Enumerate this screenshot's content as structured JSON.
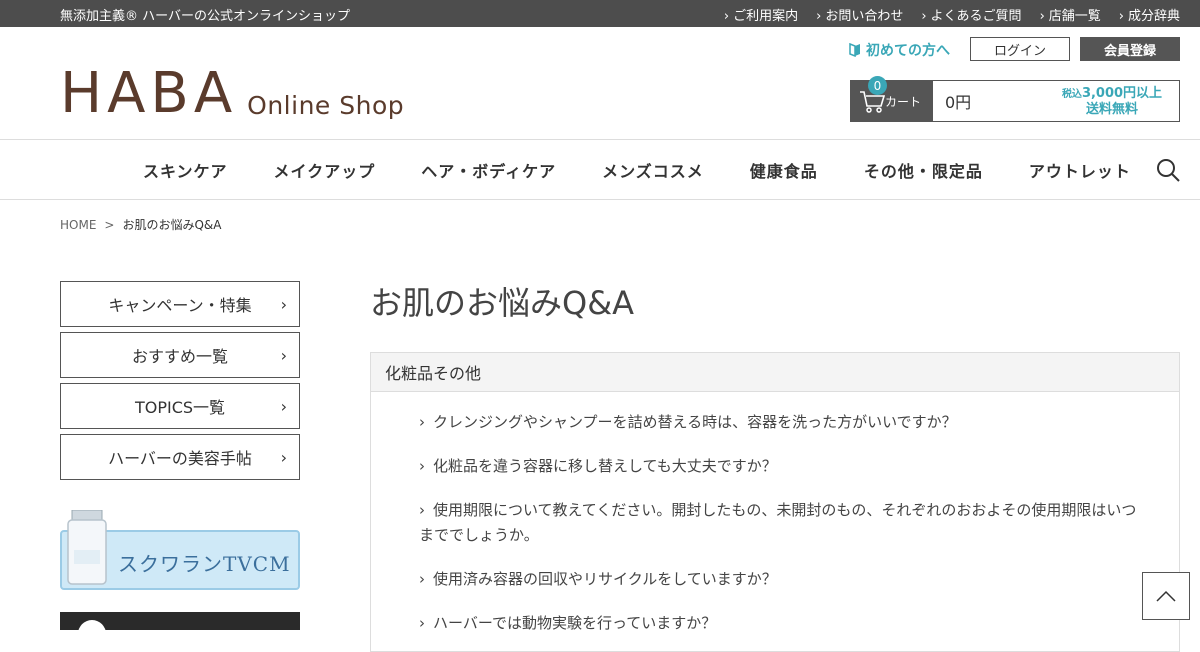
{
  "topbar": {
    "tagline": "無添加主義® ハーバーの公式オンラインショップ",
    "links": [
      "ご利用案内",
      "お問い合わせ",
      "よくあるご質問",
      "店舗一覧",
      "成分辞典"
    ]
  },
  "logo": {
    "brand": "HABA",
    "sub": "Online Shop"
  },
  "header": {
    "first_time": "初めての方へ",
    "login": "ログイン",
    "register": "会員登録",
    "cart": {
      "count": "0",
      "label": "カート",
      "amount": "0円",
      "free_small": "税込",
      "free_line1": "3,000円以上",
      "free_line2": "送料無料"
    }
  },
  "nav": [
    "スキンケア",
    "メイクアップ",
    "ヘア・ボディケア",
    "メンズコスメ",
    "健康食品",
    "その他・限定品",
    "アウトレット"
  ],
  "breadcrumb": {
    "home": "HOME",
    "sep": ">",
    "current": "お肌のお悩みQ&A"
  },
  "sidebar": {
    "items": [
      {
        "label": "キャンペーン・特集"
      },
      {
        "label": "おすすめ一覧"
      },
      {
        "label": "TOPICS一覧"
      },
      {
        "label": "ハーバーの美容手帖"
      }
    ],
    "banner_text": "スクワランTVCM"
  },
  "main": {
    "title": "お肌のお悩みQ&A",
    "section": "化粧品その他",
    "questions": [
      "クレンジングやシャンプーを詰め替える時は、容器を洗った方がいいですか？",
      "化粧品を違う容器に移し替えしても大丈夫ですか？",
      "使用期限について教えてください。開封したもの、未開封のもの、それぞれのおおよその使用期限はいつまででしょうか。",
      "使用済み容器の回収やリサイクルをしていますか？",
      "ハーバーでは動物実験を行っていますか？"
    ]
  },
  "colors": {
    "topbar": "#4d4d4d",
    "accent": "#3aa7b7",
    "brand": "#5a3b2c"
  }
}
